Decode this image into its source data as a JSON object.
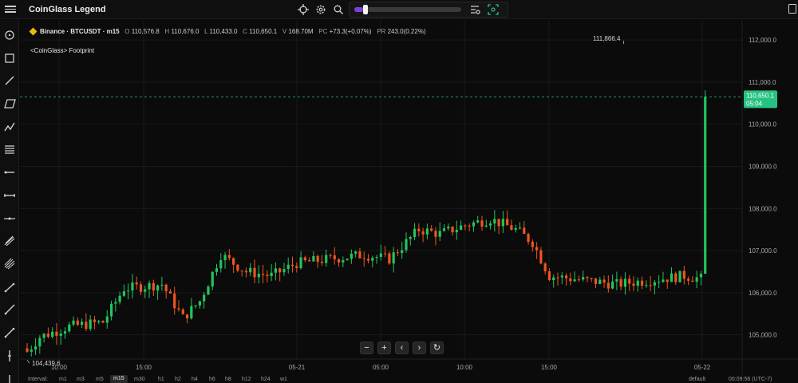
{
  "app": {
    "title": "CoinGlass Legend"
  },
  "toolbar": {
    "menu_icon": "hamburger-icon",
    "crosshair_icon": "crosshair-icon",
    "settings_icon": "gear-icon",
    "search_icon": "search-icon",
    "list_icon": "list-settings-icon",
    "screenshot_icon": "capture-icon",
    "slider_level": 0.08
  },
  "left_tools": [
    "crosshair-icon",
    "rectangle-icon",
    "trend-line-icon",
    "parallel-channel-icon",
    "path-icon",
    "fib-retracement-icon",
    "horizontal-ray-icon",
    "horizontal-line-icon",
    "arrow-line-icon",
    "pitchfork-icon",
    "gann-icon",
    "segment-icon",
    "ray-icon",
    "ruler-icon",
    "vertical-line-icon",
    "text-icon"
  ],
  "legend": {
    "exchange": "Binance",
    "symbol": "BTCUSDT",
    "interval": "m15",
    "o_label": "O",
    "o": "110,576.8",
    "h_label": "H",
    "h": "110,676.0",
    "l_label": "L",
    "l": "110,433.0",
    "c_label": "C",
    "c": "110,650.1",
    "v_label": "V",
    "v": "168.70M",
    "pc_label": "PC",
    "pc": "+73.3(+0.07%)",
    "pr_label": "PR",
    "pr": "243.0(0.22%)"
  },
  "indicator": {
    "name": "<CoinGlass> Footprint"
  },
  "nav_buttons": [
    {
      "name": "zoom-out-button",
      "label": "−"
    },
    {
      "name": "zoom-in-button",
      "label": "+"
    },
    {
      "name": "scroll-left-button",
      "label": "‹"
    },
    {
      "name": "scroll-right-button",
      "label": "›"
    },
    {
      "name": "reset-button",
      "label": "↻"
    }
  ],
  "intervals": {
    "label": "Interval:",
    "items": [
      "m1",
      "m3",
      "m5",
      "m15",
      "m30",
      "h1",
      "h2",
      "h4",
      "h6",
      "h8",
      "h12",
      "h24",
      "w1"
    ],
    "active": "m15",
    "layout_name": "default",
    "clock": "00:09:56 (UTC-7)"
  },
  "chart_data": {
    "type": "candlestick",
    "x_tick_labels": [
      "10:00",
      "15:00",
      "05-21",
      "05:00",
      "10:00",
      "15:00",
      "05-22"
    ],
    "y_tick_labels": [
      "112,000.0",
      "111,000.0",
      "110,000.0",
      "109,000.0",
      "108,000.0",
      "107,000.0",
      "106,000.0",
      "105,000.0"
    ],
    "ylim": [
      104500,
      112400
    ],
    "last_price": "110,650.1",
    "last_price_value": 110650.1,
    "countdown": "05:04",
    "high_marker": "111,866.4",
    "high_value": 111866.4,
    "low_marker": "104,439.6",
    "low_value": 104439.6,
    "up_color": "#22c55e",
    "down_color": "#f0541e",
    "last_price_color": "#26c281",
    "candle_count": 162,
    "close_path": [
      [
        0,
        104600
      ],
      [
        3,
        104950
      ],
      [
        10,
        105200
      ],
      [
        18,
        105300
      ],
      [
        23,
        106100
      ],
      [
        32,
        106200
      ],
      [
        37,
        105400
      ],
      [
        41,
        105800
      ],
      [
        46,
        106900
      ],
      [
        52,
        106500
      ],
      [
        58,
        106400
      ],
      [
        64,
        106700
      ],
      [
        72,
        106800
      ],
      [
        80,
        106900
      ],
      [
        86,
        106800
      ],
      [
        93,
        107500
      ],
      [
        98,
        107400
      ],
      [
        104,
        107600
      ],
      [
        110,
        107750
      ],
      [
        116,
        107500
      ],
      [
        120,
        107200
      ],
      [
        124,
        106400
      ],
      [
        132,
        106300
      ],
      [
        140,
        106200
      ],
      [
        148,
        106300
      ],
      [
        156,
        106400
      ],
      [
        162,
        106300
      ],
      [
        166,
        106900
      ],
      [
        170,
        107600
      ],
      [
        174,
        108000
      ],
      [
        178,
        108900
      ],
      [
        186,
        108800
      ],
      [
        194,
        108900
      ],
      [
        200,
        109400
      ],
      [
        204,
        108800
      ],
      [
        208,
        107200
      ],
      [
        214,
        106600
      ],
      [
        220,
        106500
      ],
      [
        226,
        107000
      ],
      [
        232,
        107400
      ],
      [
        238,
        108100
      ],
      [
        244,
        108200
      ],
      [
        250,
        108200
      ],
      [
        256,
        108100
      ],
      [
        260,
        108300
      ],
      [
        266,
        108700
      ],
      [
        272,
        109200
      ],
      [
        278,
        109800
      ],
      [
        284,
        109900
      ],
      [
        290,
        109700
      ],
      [
        296,
        110100
      ],
      [
        302,
        110250
      ],
      [
        308,
        110700
      ],
      [
        314,
        111400
      ],
      [
        320,
        111450
      ],
      [
        326,
        111600
      ],
      [
        330,
        111400
      ],
      [
        334,
        111300
      ],
      [
        340,
        110900
      ],
      [
        346,
        110850
      ],
      [
        348,
        110650
      ]
    ]
  }
}
